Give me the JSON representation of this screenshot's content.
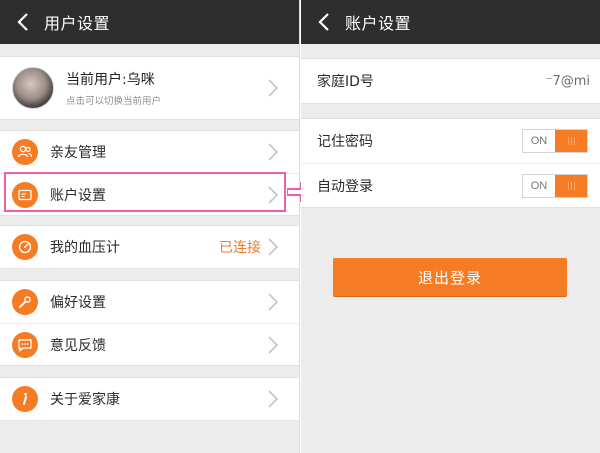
{
  "left": {
    "header": {
      "title": "用户设置"
    },
    "user": {
      "name": "当前用户:乌咪",
      "hint": "点击可以切换当前用户"
    },
    "items": {
      "friends": "亲友管理",
      "account": "账户设置",
      "monitor": "我的血压计",
      "monitor_status": "已连接",
      "preferences": "偏好设置",
      "feedback": "意见反馈",
      "about": "关于爱家康"
    }
  },
  "right": {
    "header": {
      "title": "账户设置"
    },
    "family_id": {
      "label": "家庭ID号",
      "value": "⁻7@mi"
    },
    "remember_password": {
      "label": "记住密码",
      "toggle": "ON"
    },
    "auto_login": {
      "label": "自动登录",
      "toggle": "ON"
    },
    "logout_label": "退出登录"
  },
  "colors": {
    "accent": "#f57b24",
    "header_bg": "#2e2e2e",
    "highlight": "#f05fa6"
  },
  "icons": {
    "back": "chevron-left-icon",
    "chevron": "chevron-right-icon",
    "friends": "people-icon",
    "account": "card-icon",
    "monitor": "meter-icon",
    "preferences": "wrench-icon",
    "feedback": "chat-icon",
    "about": "info-icon"
  }
}
